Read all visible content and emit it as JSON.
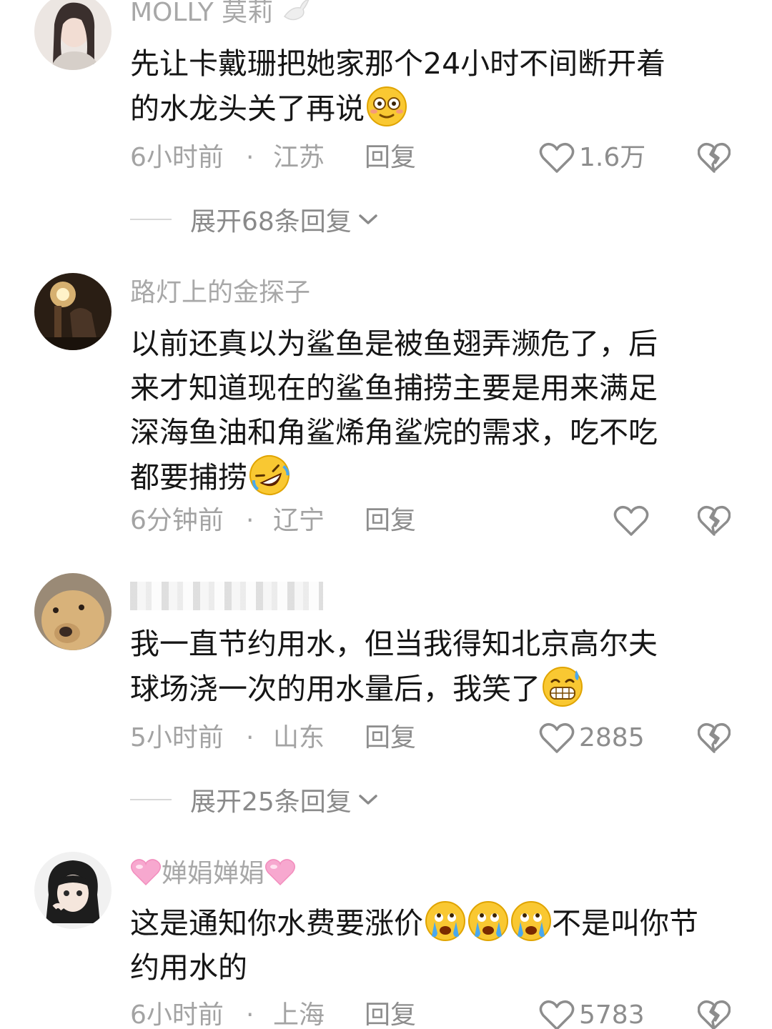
{
  "comments": [
    {
      "username": "MOLLY  莫莉",
      "text_lines": [
        "先让卡戴珊把她家那个24小时不间断开着",
        "的水龙头关了再说"
      ],
      "emoji": "flushed-emoji",
      "time": "6小时前",
      "dot": "·",
      "location": "江苏",
      "reply": "回复",
      "likes": "1.6万",
      "expand": "展开68条回复"
    },
    {
      "username": "路灯上的金探子",
      "text_lines": [
        "以前还真以为鲨鱼是被鱼翅弄濒危了，后",
        "来才知道现在的鲨鱼捕捞主要是用来满足",
        "深海鱼油和角鲨烯角鲨烷的需求，吃不吃",
        "都要捕捞"
      ],
      "emoji": "rofl-emoji",
      "time": "6分钟前",
      "dot": "·",
      "location": "辽宁",
      "reply": "回复",
      "likes": ""
    },
    {
      "username": "",
      "text_lines": [
        "我一直节约用水，但当我得知北京高尔夫",
        "球场浇一次的用水量后，我笑了"
      ],
      "emoji": "grin-sweat-emoji",
      "time": "5小时前",
      "dot": "·",
      "location": "山东",
      "reply": "回复",
      "likes": "2885",
      "expand": "展开25条回复"
    },
    {
      "username": "婵娟婵娟",
      "text_line1_a": "这是通知你水费要涨价",
      "text_line1_b": "不是叫你节",
      "text_line2": "约用水的",
      "emoji": "crying-emoji",
      "time": "6小时前",
      "dot": "·",
      "location": "上海",
      "reply": "回复",
      "likes": "5783"
    }
  ],
  "colors": {
    "username": "#a8a8a8",
    "text": "#161616",
    "meta": "#a3a3a3",
    "emoji_yellow": "#f9c832",
    "pink_heart": "#f7a8cf"
  }
}
